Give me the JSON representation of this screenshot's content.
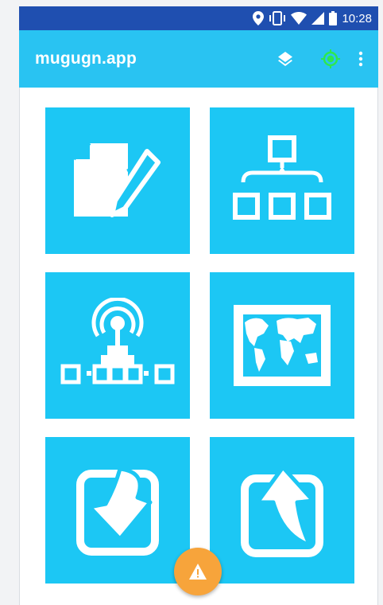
{
  "status_bar": {
    "time": "10:28",
    "icons": [
      "location-icon",
      "vibrate-icon",
      "wifi-icon",
      "signal-icon",
      "battery-icon"
    ]
  },
  "app_bar": {
    "title": "mugugn.app",
    "actions": [
      "layers-icon",
      "gps-target-icon",
      "more-vert-icon"
    ],
    "gps_color": "#2ee84e"
  },
  "tiles": [
    {
      "icon": "edit-document-icon"
    },
    {
      "icon": "hierarchy-icon"
    },
    {
      "icon": "broadcast-sensor-icon"
    },
    {
      "icon": "world-map-icon"
    },
    {
      "icon": "download-icon"
    },
    {
      "icon": "upload-icon"
    }
  ],
  "fab": {
    "icon": "warning-icon"
  },
  "colors": {
    "status_bar": "#1f4fb0",
    "app_bar": "#29c3f2",
    "tile": "#1cc7f4",
    "fab": "#f7a43b"
  }
}
